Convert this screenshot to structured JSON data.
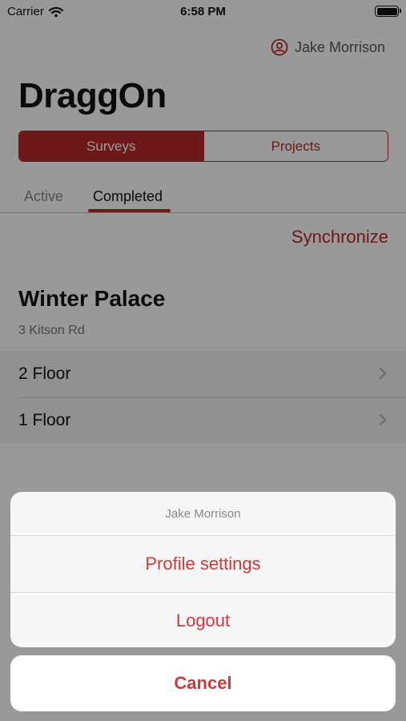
{
  "status_bar": {
    "carrier": "Carrier",
    "time": "6:58 PM",
    "battery_level": 1.0
  },
  "header": {
    "user_name": "Jake Morrison",
    "app_title": "DraggOn"
  },
  "segments": {
    "surveys": "Surveys",
    "projects": "Projects",
    "selected": "Surveys"
  },
  "subtabs": {
    "active": "Active",
    "completed": "Completed",
    "selected": "Completed"
  },
  "sync_label": "Synchronize",
  "building": {
    "name": "Winter Palace",
    "address": "3 Kitson Rd",
    "floors": [
      {
        "label": "2 Floor"
      },
      {
        "label": "1 Floor"
      }
    ]
  },
  "action_sheet": {
    "title": "Jake Morrison",
    "actions": [
      {
        "label": "Profile settings"
      },
      {
        "label": "Logout"
      }
    ],
    "cancel": "Cancel"
  },
  "colors": {
    "accent": "#b8282b",
    "destructive": "#d0383c",
    "overlay": "rgba(0,0,0,0.4)"
  },
  "icons": {
    "wifi": "wifi-icon",
    "battery": "battery-icon",
    "user": "user-circle-icon",
    "chevron": "chevron-right-icon"
  }
}
